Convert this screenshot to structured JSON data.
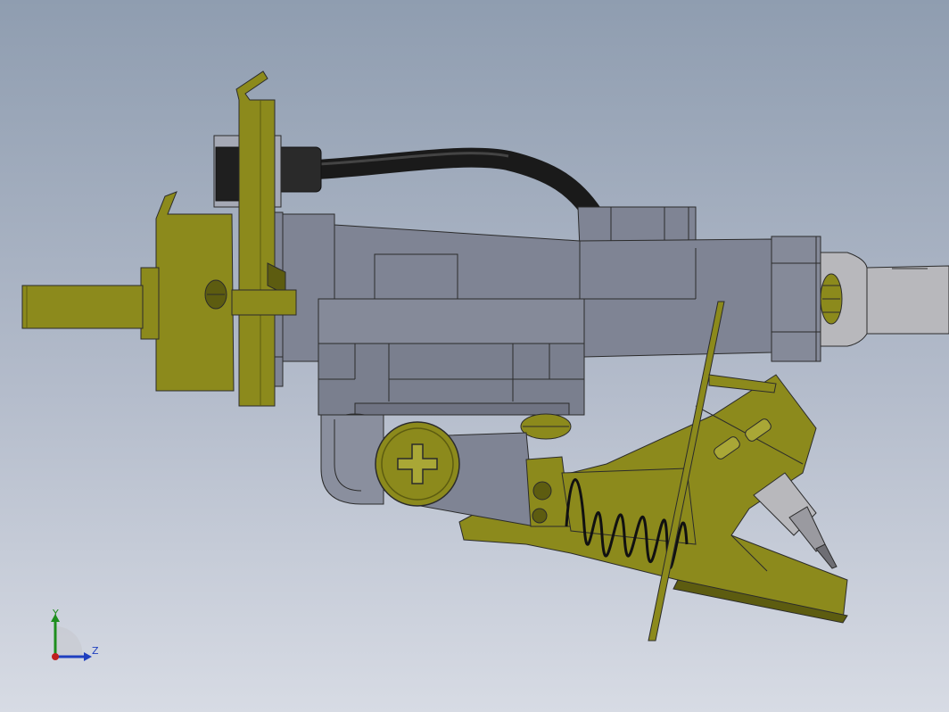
{
  "viewport": {
    "background_top": "#8f9db0",
    "background_bottom": "#d7dbe4"
  },
  "colors": {
    "olive_part": "#8c8a1c",
    "olive_dark": "#5d5c10",
    "steel_part": "#7f8494",
    "steel_dark": "#5f6372",
    "steel_light": "#9fa3b0",
    "cable": "#1a1a1a",
    "silver": "#b8b8bc",
    "outline": "#2b2b2b"
  },
  "triad": {
    "y_label": "Y",
    "z_label": "Z",
    "y_color": "#1e8e1e",
    "z_color": "#1f3fbf",
    "x_color": "#c0201f"
  }
}
